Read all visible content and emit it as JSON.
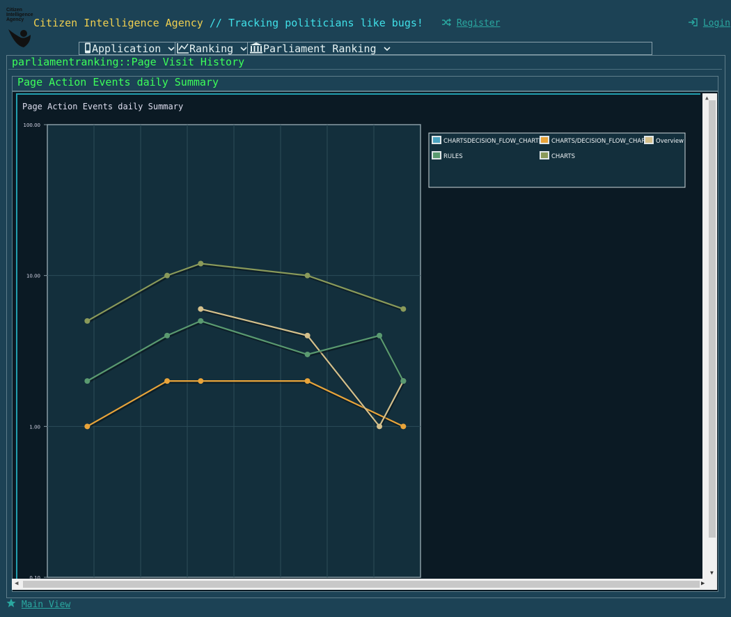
{
  "header": {
    "logo_text": "Citizen Intelligence Agency",
    "brand_name": "Citizen Intelligence Agency",
    "brand_tagline": "// Tracking politicians like bugs!",
    "register_label": "Register",
    "login_label": "Login",
    "register_icon": "shuffle-icon",
    "login_icon": "sign-in-icon"
  },
  "menu": {
    "items": [
      {
        "label": "Application",
        "icon": "mobile-icon"
      },
      {
        "label": "Ranking",
        "icon": "line-chart-icon"
      },
      {
        "label": "Parliament Ranking",
        "icon": "institution-icon"
      }
    ]
  },
  "breadcrumb": "parliamentranking::Page Visit History",
  "panel_title": "Page Action Events daily Summary",
  "chart_data": {
    "type": "line",
    "title": "Page Action Events daily Summary",
    "yscale": "log",
    "ylim": [
      0.1,
      100
    ],
    "ytick_labels": [
      "100.00",
      "10.00",
      "1.00",
      "0.10"
    ],
    "grid": true,
    "legend_position": "right",
    "series": [
      {
        "name": "CHARTSDECISION_FLOW_CHART[]",
        "color": "#4aa3c0",
        "points": []
      },
      {
        "name": "CHARTS/DECISION_FLOW_CHART",
        "color": "#e8a43a",
        "points": [
          [
            0.107,
            1
          ],
          [
            0.321,
            2
          ],
          [
            0.411,
            2
          ],
          [
            0.697,
            2
          ],
          [
            0.954,
            1
          ]
        ]
      },
      {
        "name": "Overview",
        "color": "#d4c08c",
        "points": [
          [
            0.411,
            6
          ],
          [
            0.697,
            4
          ],
          [
            0.89,
            1
          ],
          [
            0.954,
            2
          ]
        ]
      },
      {
        "name": "RULES",
        "color": "#5a9a70",
        "points": [
          [
            0.107,
            2
          ],
          [
            0.321,
            4
          ],
          [
            0.411,
            5
          ],
          [
            0.697,
            3
          ],
          [
            0.89,
            4
          ],
          [
            0.954,
            2
          ]
        ]
      },
      {
        "name": "CHARTS",
        "color": "#8a9a5a",
        "points": [
          [
            0.107,
            5
          ],
          [
            0.321,
            10
          ],
          [
            0.411,
            12
          ],
          [
            0.697,
            10
          ],
          [
            0.954,
            6
          ]
        ]
      }
    ]
  },
  "footer": {
    "main_view_label": "Main View",
    "main_view_icon": "star-icon"
  }
}
